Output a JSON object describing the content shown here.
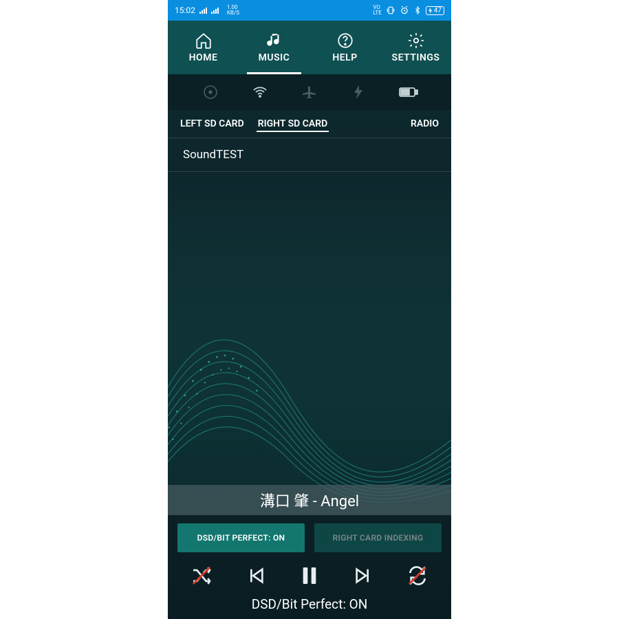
{
  "status": {
    "time": "15:02",
    "kbs_top": "1.00",
    "kbs_bot": "KB/S",
    "volte": "VO\nLTE",
    "battery": "47"
  },
  "nav": {
    "home": "HOME",
    "music": "MUSIC",
    "help": "HELP",
    "settings": "SETTINGS"
  },
  "subtabs": {
    "left": "LEFT SD CARD",
    "right": "RIGHT SD CARD",
    "radio": "RADIO"
  },
  "list": {
    "item0": "SoundTEST"
  },
  "now_playing": "溝口 肇 - Angel",
  "buttons": {
    "dsd": "DSD/BIT PERFECT: ON",
    "indexing": "RIGHT CARD INDEXING"
  },
  "footer_status": "DSD/Bit Perfect: ON"
}
